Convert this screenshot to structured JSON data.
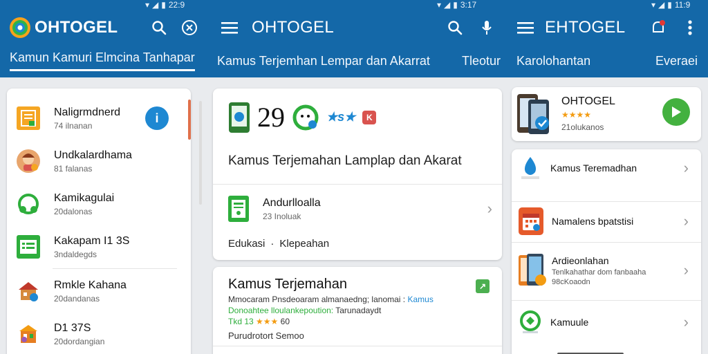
{
  "statusbar": {
    "left_time": "22:9",
    "mid_time": "3:17",
    "right_time": "11:9"
  },
  "appbars": [
    {
      "title": "OHTOGEL"
    },
    {
      "title": "OHTOGEL"
    },
    {
      "title": "EHTOGEL"
    }
  ],
  "tabs": [
    "Kamun Kamuri Elmcina Tanhapar",
    "Kamus Terjemhan Lempar dan Akarrat",
    "Tleotur",
    "Karolohantan",
    "Everaei"
  ],
  "left_list": [
    {
      "title": "Naligrmdnerd",
      "sub": "74 ilnanan"
    },
    {
      "title": "Undkalardhama",
      "sub": "81 falanas"
    },
    {
      "title": "Kamikagulai",
      "sub": "20dalonas"
    },
    {
      "title": "Kakapam I1 3S",
      "sub": "3ndaldegds"
    },
    {
      "title": "Rmkle Kahana",
      "sub": "20dandanas"
    },
    {
      "title": "D1 37S",
      "sub": "20dordangian"
    }
  ],
  "middle": {
    "top_card": {
      "icon_glyphs": {
        "number": "29",
        "rating": "★s★",
        "badge": "K"
      },
      "headline": "Kamus Terjemahan Lamplap dan Akarat",
      "item_title": "Andurlloalla",
      "item_sub": "23 Inoluak",
      "category": "Edukasi",
      "category_sep": "·",
      "category_value": "Klepeahan"
    },
    "second_card": {
      "title": "Kamus Terjemahan",
      "line1_dark": "Mmocaram Pnsdeoaram almanaedng; lanomai :",
      "line1_link": "Kamus",
      "line2_link": "Donoahtee lloulankepoution:",
      "line2_dark": "Tarunadaydt",
      "rating_prefix": "Tkd 13",
      "rating_stars": "★★★",
      "rating_suffix": "60",
      "footer": "Purudrotort Semoo"
    }
  },
  "right": {
    "app": {
      "title": "OHTOGEL",
      "stars": "★★★★",
      "sub": "21olukanos"
    },
    "list": [
      {
        "title": "Kamus Teremadhan",
        "sub": ""
      },
      {
        "title": "Namalens bpatstisi",
        "sub": ""
      },
      {
        "title": "Ardieonlahan",
        "sub": "Tenlkahathar dom fanbaaha",
        "sub2": "98cKoaodn"
      },
      {
        "title": "Kamuule",
        "sub": ""
      }
    ]
  },
  "colors": {
    "header": "#1468a8",
    "accent_green": "#2eae3c",
    "accent_blue": "#1e88d2",
    "accent_orange": "#f39c12"
  }
}
